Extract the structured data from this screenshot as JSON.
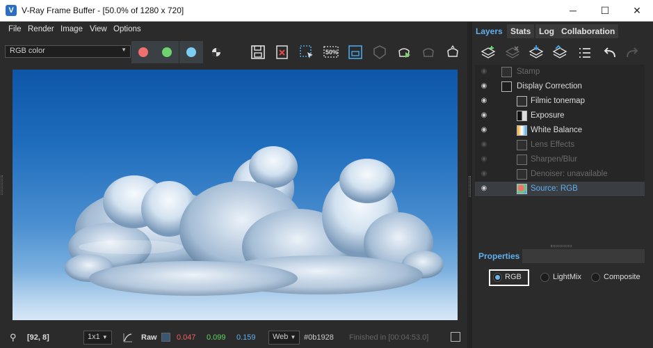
{
  "window": {
    "title": "V-Ray Frame Buffer - [50.0% of 1280 x 720]",
    "app_icon": "vray-logo-icon",
    "controls": {
      "minimize": "─",
      "maximize": "☐",
      "close": "✕"
    }
  },
  "menubar": {
    "items": [
      "File",
      "Render",
      "Image",
      "View",
      "Options"
    ]
  },
  "toolbar": {
    "channel": "RGB color",
    "channel_buttons": [
      {
        "name": "red-channel-button",
        "color": "#f07070"
      },
      {
        "name": "green-channel-button",
        "color": "#6fd16f"
      },
      {
        "name": "blue-channel-button",
        "color": "#7ccdf3"
      }
    ],
    "zoom_badge": "50%"
  },
  "status": {
    "coords": "[92, 8]",
    "sampling": "1x1",
    "raw_label": "Raw",
    "swatch_color": "#0b1928",
    "r": "0.047",
    "g": "0.099",
    "b": "0.159",
    "colorspace": "Web",
    "hex": "#0b1928",
    "finished": "Finished in [00:04:53.0]"
  },
  "right": {
    "tabs": [
      "Layers",
      "Stats",
      "Log",
      "Collaboration"
    ],
    "layers": [
      {
        "label": "Stamp",
        "visible": false,
        "indent": 1
      },
      {
        "label": "Display Correction",
        "visible": true,
        "indent": 1
      },
      {
        "label": "Filmic tonemap",
        "visible": true,
        "indent": 2
      },
      {
        "label": "Exposure",
        "visible": true,
        "indent": 2
      },
      {
        "label": "White Balance",
        "visible": true,
        "indent": 2
      },
      {
        "label": "Lens Effects",
        "visible": false,
        "indent": 2
      },
      {
        "label": "Sharpen/Blur",
        "visible": false,
        "indent": 2
      },
      {
        "label": "Denoiser: unavailable",
        "visible": false,
        "indent": 2
      },
      {
        "label": "Source: RGB",
        "visible": true,
        "indent": 2,
        "selected": true
      }
    ],
    "properties_label": "Properties",
    "radios": [
      {
        "label": "RGB",
        "checked": true
      },
      {
        "label": "LightMix",
        "checked": false
      },
      {
        "label": "Composite",
        "checked": false
      }
    ]
  }
}
